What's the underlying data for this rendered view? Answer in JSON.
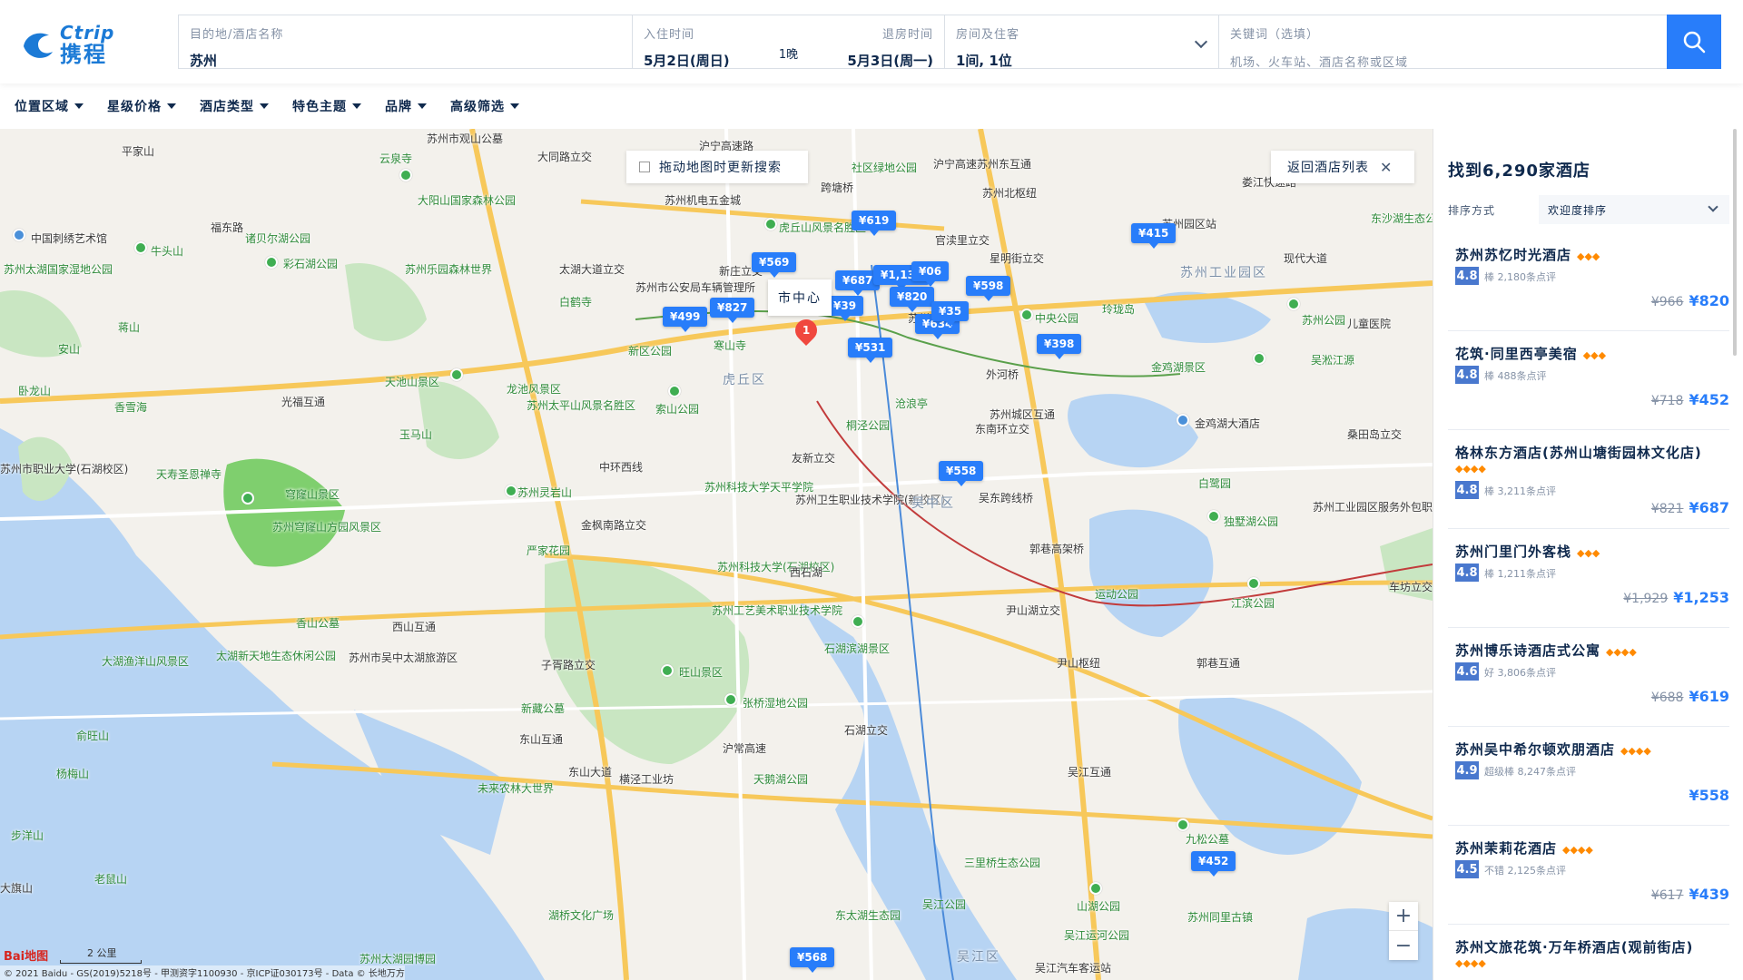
{
  "logo": {
    "en": "Ctrip",
    "cn": "携程"
  },
  "search": {
    "dest_label": "目的地/酒店名称",
    "dest_value": "苏州",
    "checkin_label": "入住时间",
    "checkin_value": "5月2日(周日)",
    "nights": "1晚",
    "checkout_label": "退房时间",
    "checkout_value": "5月3日(周一)",
    "guests_label": "房间及住客",
    "guests_value": "1间, 1位",
    "keyword_label": "关键词（选填）",
    "keyword_placeholder": "机场、火车站、酒店名称或区域"
  },
  "filters": [
    "位置区域",
    "星级价格",
    "酒店类型",
    "特色主题",
    "品牌",
    "高级筛选"
  ],
  "map": {
    "toggle_label": "拖动地图时更新搜索",
    "return_label": "返回酒店列表",
    "center_label": "市中心",
    "center_pin": "1",
    "zoom_in": "+",
    "zoom_out": "−",
    "scale": "2 公里",
    "baidu": "Bai地图",
    "copyright": "© 2021 Baidu - GS(2019)5218号 - 甲测资字1100930 - 京ICP证030173号 - Data © 长地万方",
    "price_pins": [
      {
        "label": "¥619"
      },
      {
        "label": "¥415"
      },
      {
        "label": "¥569"
      },
      {
        "label": "¥687"
      },
      {
        "label": "¥1,130"
      },
      {
        "label": "¥06"
      },
      {
        "label": "¥598"
      },
      {
        "label": "¥820"
      },
      {
        "label": "¥39"
      },
      {
        "label": "¥827"
      },
      {
        "label": "¥499"
      },
      {
        "label": "¥634"
      },
      {
        "label": "¥35"
      },
      {
        "label": "¥531"
      },
      {
        "label": "¥398"
      },
      {
        "label": "¥558"
      },
      {
        "label": "¥452"
      },
      {
        "label": "¥568"
      }
    ],
    "labels": {
      "l1": "苏州市观山公墓",
      "l2": "大同路立交",
      "l3": "沪宁高速路",
      "l4": "社区绿地公园",
      "l5": "沪宁高速苏州东互通",
      "l6": "平家山",
      "l7": "云泉寺",
      "l8": "大阳山国家森林公园",
      "l9": "福东路",
      "l10": "苏州机电五金城",
      "l11": "虎丘山风景名胜区",
      "l12": "官渎里立交",
      "l13": "苏州北枢纽",
      "l14": "娄江快速路",
      "l15": "苏州园区站",
      "l16": "东沙湖生态公园",
      "l17": "中国刺绣艺术馆",
      "l18": "诸贝尔湖公园",
      "l19": "牛头山",
      "l20": "彩石湖公园",
      "l21": "苏州乐园森林世界",
      "l22": "太湖大道立交",
      "l23": "苏州市公安局车辆管理所",
      "l24": "新庄立交",
      "l25": "跨塘桥",
      "l26": "星明街立交",
      "l27": "苏州工业园区",
      "l28": "现代大道",
      "l29": "苏州太湖国家湿地公园",
      "l30": "白鹤寺",
      "l31": "寒山寺",
      "l32": "苏州大学",
      "l33": "中央公园",
      "l34": "玲珑岛",
      "l35": "苏州公园",
      "l36": "儿童医院",
      "l37": "蒋山",
      "l38": "新区公园",
      "l39": "金鸡湖景区",
      "l40": "吴淞江源",
      "l41": "安山",
      "l42": "光福互通",
      "l43": "天池山景区",
      "l44": "龙池风景区",
      "l45": "虎丘区",
      "l46": "沧浪亭",
      "l47": "外河桥",
      "l48": "卧龙山",
      "l49": "香雪海",
      "l50": "苏州太平山风景名胜区",
      "l51": "索山公园",
      "l52": "桐泾公园",
      "l53": "苏州城区互通",
      "l54": "东南环立交",
      "l55": "金鸡湖大酒店",
      "l56": "桑田岛立交",
      "l57": "玉马山",
      "l58": "苏州市职业大学(石湖校区)",
      "l59": "天寿圣恩禅寺",
      "l60": "穹窿山景区",
      "l61": "友新立交",
      "l62": "中环西线",
      "l63": "苏州科技大学天平学院",
      "l64": "苏州卫生职业技术学院(新校区)",
      "l65": "吴中区",
      "l66": "吴东跨线桥",
      "l67": "白鹭园",
      "l68": "苏州工业园区服务外包职业学院",
      "l69": "苏州灵岩山",
      "l70": "苏州穹窿山方园风景区",
      "l71": "金枫南路立交",
      "l72": "严家花园",
      "l73": "郭巷高架桥",
      "l74": "独墅湖公园",
      "l75": "苏州科技大学(石湖校区)",
      "l76": "西石湖",
      "l77": "车坊立交",
      "l78": "香山公墓",
      "l79": "西山互通",
      "l80": "苏州工艺美术职业技术学院",
      "l81": "江滨公园",
      "l82": "运动公园",
      "l83": "尹山湖立交",
      "l84": "太湖新天地生态休闲公园",
      "l85": "苏州市吴中太湖旅游区",
      "l86": "子胥路立交",
      "l87": "旺山景区",
      "l88": "石湖滨湖景区",
      "l89": "尹山枢纽",
      "l90": "郭巷互通",
      "l91": "大湖渔洋山风景区",
      "l92": "新藏公墓",
      "l93": "张桥湿地公园",
      "l94": "俞旺山",
      "l95": "东山互通",
      "l96": "沪常高速",
      "l97": "石湖立交",
      "l98": "杨梅山",
      "l99": "东山大道",
      "l100": "横泾工业坊",
      "l101": "天鹅湖公园",
      "l102": "吴江互通",
      "l103": "未来农林大世界",
      "l104": "九松公墓",
      "l105": "步洋山",
      "l106": "三里桥生态公园",
      "l107": "老鼠山",
      "l108": "大旗山",
      "l109": "湖桥文化广场",
      "l110": "东太湖生态园",
      "l111": "吴江公园",
      "l112": "山湖公园",
      "l113": "吴江运河公园",
      "l114": "苏州同里古镇",
      "l115": "苏州太湖园博园",
      "l116": "吴江区",
      "l117": "吴江汽车客运站",
      "l118": "苏州大学"
    }
  },
  "panel": {
    "found": "找到6,290家酒店",
    "sort_label": "排序方式",
    "sort_value": "欢迎度排序",
    "hotels": [
      {
        "name": "苏州苏忆时光酒店",
        "diamonds": "◆◆◆",
        "score": "4.8",
        "review": "棒 2,180条点评",
        "old_price": "¥966",
        "price": "¥820"
      },
      {
        "name": "花筑·同里西亭美宿",
        "diamonds": "◆◆◆",
        "score": "4.8",
        "review": "棒 488条点评",
        "old_price": "¥718",
        "price": "¥452"
      },
      {
        "name": "格林东方酒店(苏州山塘街园林文化店)",
        "diamonds": "◆◆◆◆",
        "score": "4.8",
        "review": "棒 3,211条点评",
        "old_price": "¥821",
        "price": "¥687"
      },
      {
        "name": "苏州门里门外客栈",
        "diamonds": "◆◆◆",
        "score": "4.8",
        "review": "棒 1,211条点评",
        "old_price": "¥1,929",
        "price": "¥1,253"
      },
      {
        "name": "苏州博乐诗酒店式公寓",
        "diamonds": "◆◆◆◆",
        "score": "4.6",
        "review": "好 3,806条点评",
        "old_price": "¥688",
        "price": "¥619"
      },
      {
        "name": "苏州吴中希尔顿欢朋酒店",
        "diamonds": "◆◆◆◆",
        "score": "4.9",
        "review": "超级棒 8,247条点评",
        "old_price": "",
        "price": "¥558"
      },
      {
        "name": "苏州茉莉花酒店",
        "diamonds": "◆◆◆◆",
        "score": "4.5",
        "review": "不错 2,125条点评",
        "old_price": "¥617",
        "price": "¥439"
      },
      {
        "name": "苏州文旅花筑·万年桥酒店(观前街店)",
        "diamonds": "◆◆◆◆",
        "score": "",
        "review": "",
        "old_price": "",
        "price": ""
      }
    ]
  },
  "colors": {
    "accent": "#287dfa",
    "price_old": "#8592a6",
    "diamond": "#ff8a00",
    "score_bg": "#4978ce",
    "pin_red": "#f0483e"
  }
}
